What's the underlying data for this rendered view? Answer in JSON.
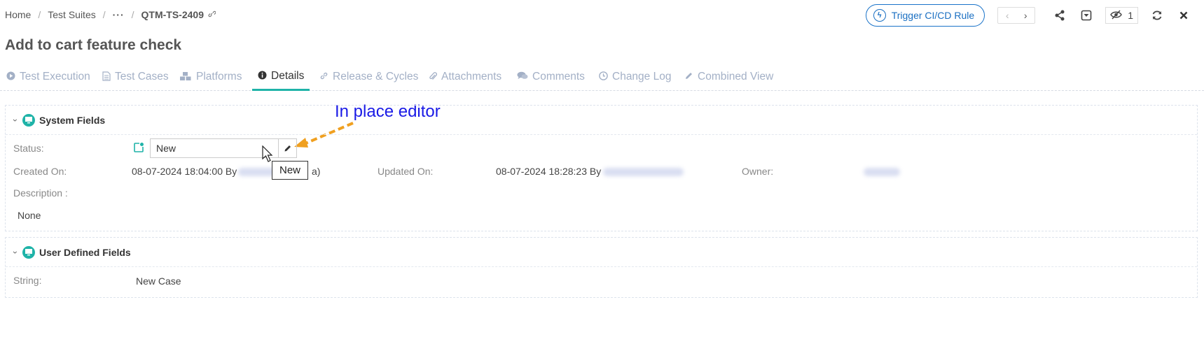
{
  "breadcrumb": {
    "items": [
      "Home",
      "Test Suites",
      "..."
    ],
    "current": "QTM-TS-2409"
  },
  "toolbar": {
    "trigger_label": "Trigger CI/CD Rule",
    "watch_count": "1"
  },
  "page": {
    "title": "Add to cart feature check"
  },
  "tabs": [
    {
      "label": "Test Execution",
      "icon": "play-circle-icon"
    },
    {
      "label": "Test Cases",
      "icon": "document-icon"
    },
    {
      "label": "Platforms",
      "icon": "cubes-icon"
    },
    {
      "label": "Details",
      "icon": "info-icon",
      "active": true
    },
    {
      "label": "Release & Cycles",
      "icon": "link-icon"
    },
    {
      "label": "Attachments",
      "icon": "paperclip-icon"
    },
    {
      "label": "Comments",
      "icon": "comments-icon"
    },
    {
      "label": "Change Log",
      "icon": "clock-icon"
    },
    {
      "label": "Combined View",
      "icon": "pencil-icon"
    }
  ],
  "system_fields": {
    "title": "System Fields",
    "status_label": "Status:",
    "status_value": "New",
    "created_label": "Created On:",
    "created_value": "08-07-2024 18:04:00 By",
    "created_suffix": "a)",
    "updated_label": "Updated On:",
    "updated_value": "08-07-2024 18:28:23 By",
    "owner_label": "Owner:",
    "description_label": "Description :",
    "description_value": "None"
  },
  "tooltip": {
    "text": "New"
  },
  "annotation": {
    "text": "In place editor",
    "color": "#1a1ae6",
    "arrow_color": "#f0a020"
  },
  "user_defined_fields": {
    "title": "User Defined Fields",
    "string_label": "String:",
    "string_value": "New Case"
  },
  "colors": {
    "accent": "#1fb3a8",
    "link_blue": "#1a6fc2",
    "tab_inactive": "#a3b0c6"
  }
}
